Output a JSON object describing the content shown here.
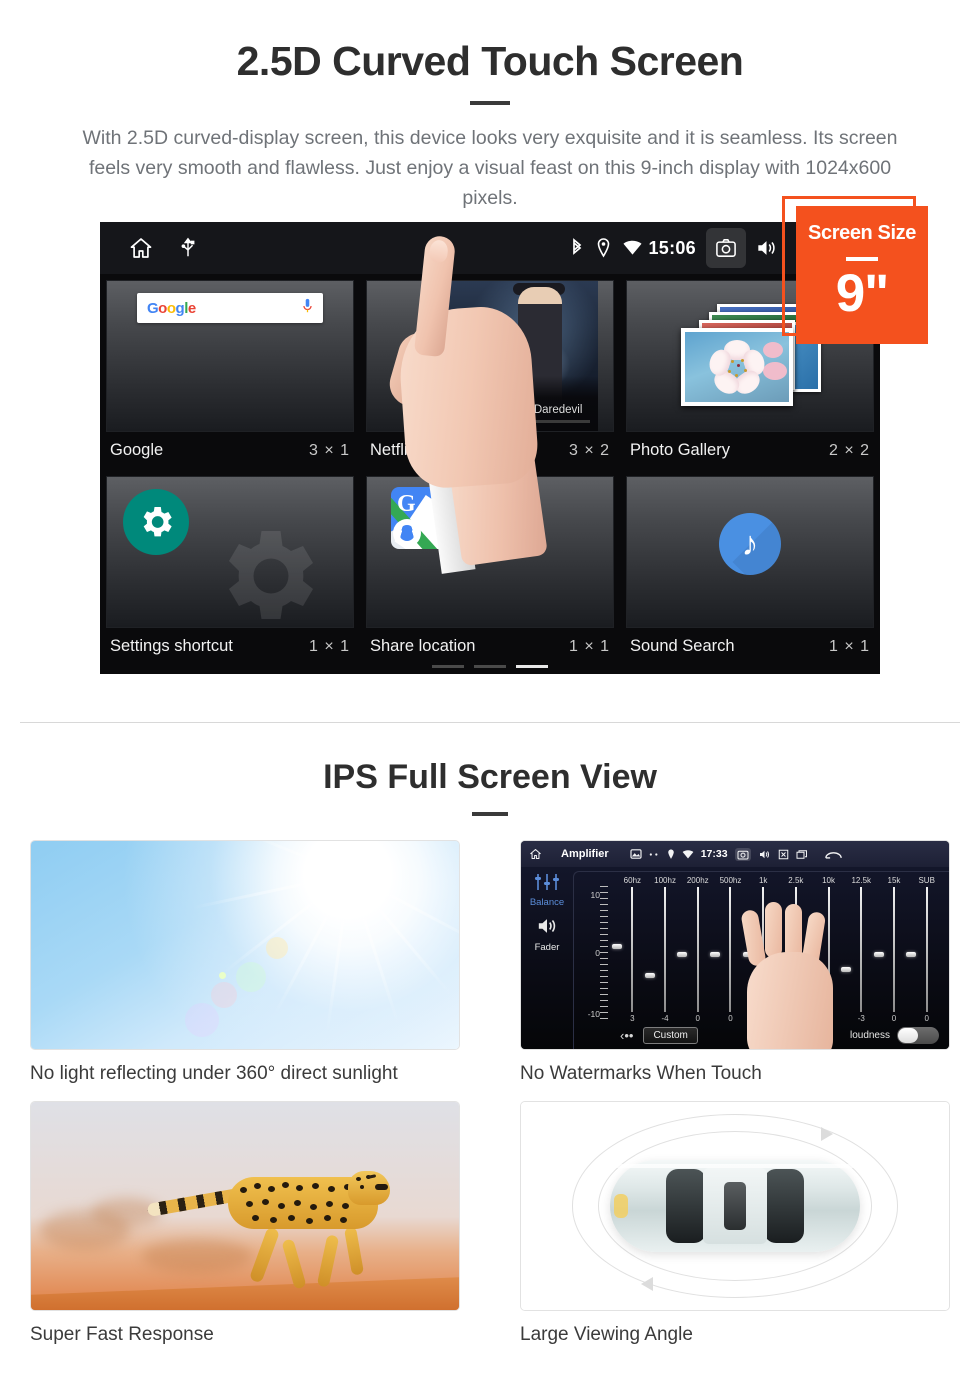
{
  "section1": {
    "title": "2.5D Curved Touch Screen",
    "body": "With 2.5D curved-display screen, this device looks very exquisite and it is seamless. Its screen feels very smooth and flawless. Just enjoy a visual feast on this 9-inch display with 1024x600 pixels."
  },
  "badge": {
    "label": "Screen Size",
    "value": "9\"",
    "color": "#F4511E"
  },
  "android": {
    "statusbar": {
      "time": "15:06",
      "left_icons": [
        "home-icon",
        "usb-icon"
      ],
      "right_icons": [
        "bluetooth-icon",
        "location-icon",
        "wifi-icon",
        "camera-icon",
        "volume-icon",
        "close-box-icon",
        "recents-icon"
      ]
    },
    "widgets": [
      {
        "name": "Google",
        "size": "3 × 1",
        "icon": "google-search-widget",
        "search_placeholder": "",
        "logo_letters": [
          "G",
          "o",
          "o",
          "g",
          "l",
          "e"
        ]
      },
      {
        "name": "Netflix",
        "size": "3 × 2",
        "icon": "netflix-widget",
        "brand": "NETFLIX",
        "subtitle": "Continue Marvel's Daredevil"
      },
      {
        "name": "Photo Gallery",
        "size": "2 × 2",
        "icon": "photo-gallery-widget"
      },
      {
        "name": "Settings shortcut",
        "size": "1 × 1",
        "icon": "gear-icon"
      },
      {
        "name": "Share location",
        "size": "1 × 1",
        "icon": "google-maps-icon"
      },
      {
        "name": "Sound Search",
        "size": "1 × 1",
        "icon": "music-note-icon"
      }
    ],
    "page_dots": {
      "count": 3,
      "active_index": 2
    }
  },
  "section2": {
    "title": "IPS Full Screen View",
    "panels": [
      {
        "caption": "No light reflecting under 360° direct sunlight",
        "image": "sunny-sky-photo"
      },
      {
        "caption": "No Watermarks When Touch",
        "image": "amplifier-equalizer-screenshot"
      },
      {
        "caption": "Super Fast Response",
        "image": "running-cheetah-photo"
      },
      {
        "caption": "Large Viewing Angle",
        "image": "car-top-view-illustration"
      }
    ]
  },
  "equalizer": {
    "title": "Amplifier",
    "time": "17:33",
    "sidebar": [
      {
        "label": "Balance",
        "icon": "sliders-icon"
      },
      {
        "label": "Fader",
        "icon": "speaker-icon"
      }
    ],
    "scale": {
      "top": "10",
      "mid": "0",
      "bottom": "-10"
    },
    "bands": [
      {
        "hz": "60hz",
        "value": "3"
      },
      {
        "hz": "100hz",
        "value": "-4"
      },
      {
        "hz": "200hz",
        "value": "0"
      },
      {
        "hz": "500hz",
        "value": "0"
      },
      {
        "hz": "1k",
        "value": "0"
      },
      {
        "hz": "2.5k",
        "value": "-3"
      },
      {
        "hz": "10k",
        "value": "0"
      },
      {
        "hz": "12.5k",
        "value": "-3"
      },
      {
        "hz": "15k",
        "value": "0"
      },
      {
        "hz": "SUB",
        "value": "0"
      }
    ],
    "preset_button": "Custom",
    "loudness_label": "loudness",
    "back_icon": "back-arrow-icon"
  }
}
